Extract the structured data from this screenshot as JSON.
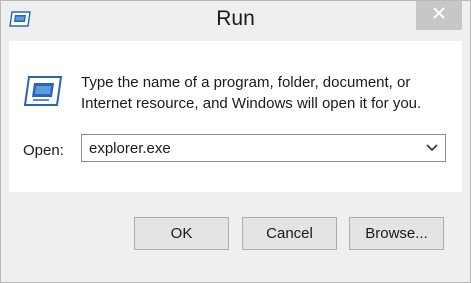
{
  "window": {
    "title": "Run",
    "icons": {
      "app": "run-icon",
      "close": "close-icon"
    }
  },
  "dialog": {
    "description": "Type the name of a program, folder, document, or Internet resource, and Windows will open it for you.",
    "icon": "run-icon",
    "open_label": "Open:",
    "open_value": "explorer.exe",
    "dropdown_icon": "chevron-down-icon"
  },
  "buttons": {
    "ok": "OK",
    "cancel": "Cancel",
    "browse": "Browse..."
  },
  "colors": {
    "window_bg": "#efefef",
    "client_bg": "#ffffff",
    "close_hover": "#c7c7c7",
    "button_bg": "#e4e4e4",
    "icon_blue": "#2b64b5"
  }
}
